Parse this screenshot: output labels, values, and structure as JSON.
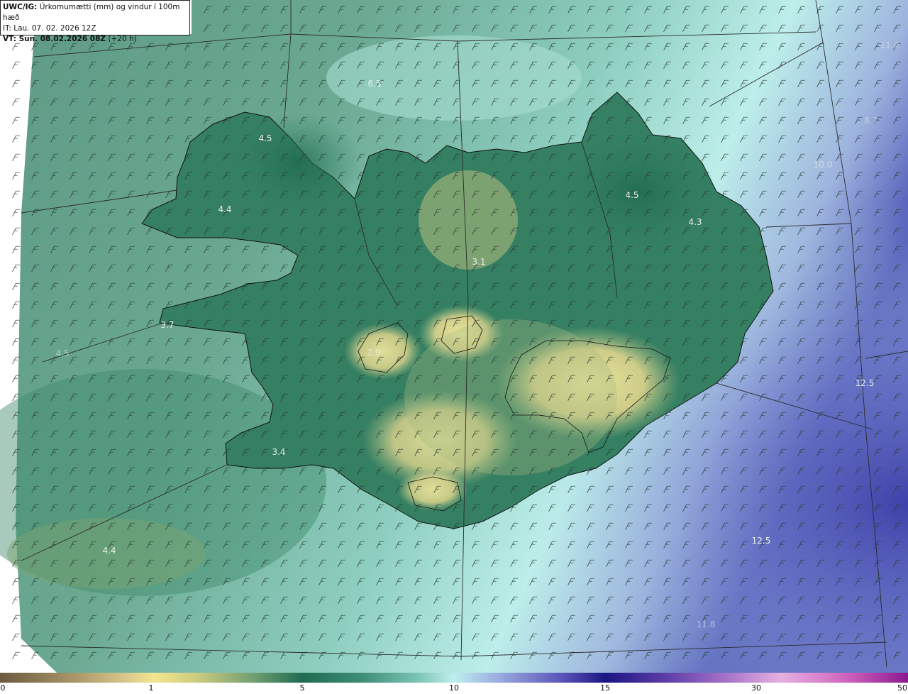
{
  "header": {
    "line1_bold": "UWC/IG:",
    "line1_rest": " Úrkomumætti (mm) og vindur í 100m hæð",
    "line2": "IT: Lau. 07. 02. 2026 12Z",
    "line3_bold": "VT: Sun. 08.02.2026 08Z",
    "line3_rest": " (+20 h)"
  },
  "map_labels": [
    {
      "id": "l1",
      "text": "6.5"
    },
    {
      "id": "l2",
      "text": "4.5"
    },
    {
      "id": "l3",
      "text": "4.4"
    },
    {
      "id": "l4",
      "text": "3.7"
    },
    {
      "id": "l5",
      "text": "4.5"
    },
    {
      "id": "l6",
      "text": "4.3"
    },
    {
      "id": "l7",
      "text": "3.1"
    },
    {
      "id": "l8",
      "text": "2.9"
    },
    {
      "id": "l9",
      "text": "3.4"
    },
    {
      "id": "l10",
      "text": "4.4"
    },
    {
      "id": "l11",
      "text": "4.5"
    },
    {
      "id": "l12",
      "text": "10.0"
    },
    {
      "id": "l13",
      "text": "12.5"
    },
    {
      "id": "l14",
      "text": "12.5"
    },
    {
      "id": "l15",
      "text": "11.8"
    },
    {
      "id": "l16",
      "text": "11.4"
    },
    {
      "id": "l17",
      "text": "8.7"
    }
  ],
  "colorbar": {
    "ticks": [
      "0",
      "1",
      "5",
      "10",
      "15",
      "30",
      "50"
    ]
  },
  "colors": {
    "sea_low": "#5f9b86",
    "land_mid": "#2f7d60",
    "highland": "#d9d389",
    "sea_high": "#bfeeea",
    "extreme": "#4a4fb0"
  }
}
